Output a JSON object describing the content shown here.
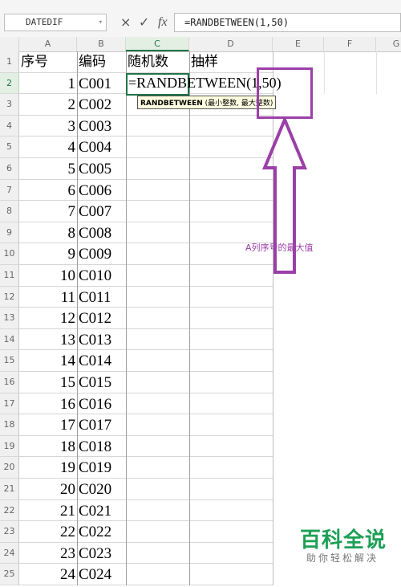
{
  "formula_bar": {
    "name_box": "DATEDIF",
    "cancel_symbol": "×",
    "confirm_symbol": "✓",
    "fx_label": "fx",
    "formula": "=RANDBETWEEN(1,50)"
  },
  "columns": [
    "A",
    "B",
    "C",
    "D",
    "E",
    "F",
    "G"
  ],
  "selected_column": "C",
  "headers": {
    "a": "序号",
    "b": "编码",
    "c": "随机数",
    "d": "抽样"
  },
  "rows": [
    {
      "row": "1"
    },
    {
      "row": "2",
      "seq": "1",
      "code": "C001"
    },
    {
      "row": "3",
      "seq": "2",
      "code": "C002"
    },
    {
      "row": "4",
      "seq": "3",
      "code": "C003"
    },
    {
      "row": "5",
      "seq": "4",
      "code": "C004"
    },
    {
      "row": "6",
      "seq": "5",
      "code": "C005"
    },
    {
      "row": "7",
      "seq": "6",
      "code": "C006"
    },
    {
      "row": "8",
      "seq": "7",
      "code": "C007"
    },
    {
      "row": "9",
      "seq": "8",
      "code": "C008"
    },
    {
      "row": "10",
      "seq": "9",
      "code": "C009"
    },
    {
      "row": "11",
      "seq": "10",
      "code": "C010"
    },
    {
      "row": "12",
      "seq": "11",
      "code": "C011"
    },
    {
      "row": "13",
      "seq": "12",
      "code": "C012"
    },
    {
      "row": "14",
      "seq": "13",
      "code": "C013"
    },
    {
      "row": "15",
      "seq": "14",
      "code": "C014"
    },
    {
      "row": "16",
      "seq": "15",
      "code": "C015"
    },
    {
      "row": "17",
      "seq": "16",
      "code": "C016"
    },
    {
      "row": "18",
      "seq": "17",
      "code": "C017"
    },
    {
      "row": "19",
      "seq": "18",
      "code": "C018"
    },
    {
      "row": "20",
      "seq": "19",
      "code": "C019"
    },
    {
      "row": "21",
      "seq": "20",
      "code": "C020"
    },
    {
      "row": "22",
      "seq": "21",
      "code": "C021"
    },
    {
      "row": "23",
      "seq": "22",
      "code": "C022"
    },
    {
      "row": "24",
      "seq": "23",
      "code": "C023"
    },
    {
      "row": "25",
      "seq": "24",
      "code": "C024"
    }
  ],
  "editing": {
    "cell_text": "=RANDBETWEEN(1,50)",
    "tooltip_func": "RANDBETWEEN",
    "tooltip_args": " (最小整数, 最大整数)"
  },
  "annotation": {
    "text": "A列序号的最大值",
    "color": "#9b3fa8"
  },
  "watermark": {
    "title": "百科全说",
    "subtitle": "助你轻松解决"
  },
  "colors": {
    "accent": "#217346",
    "annotation": "#9b3fa8",
    "watermark": "#1c9f55"
  }
}
